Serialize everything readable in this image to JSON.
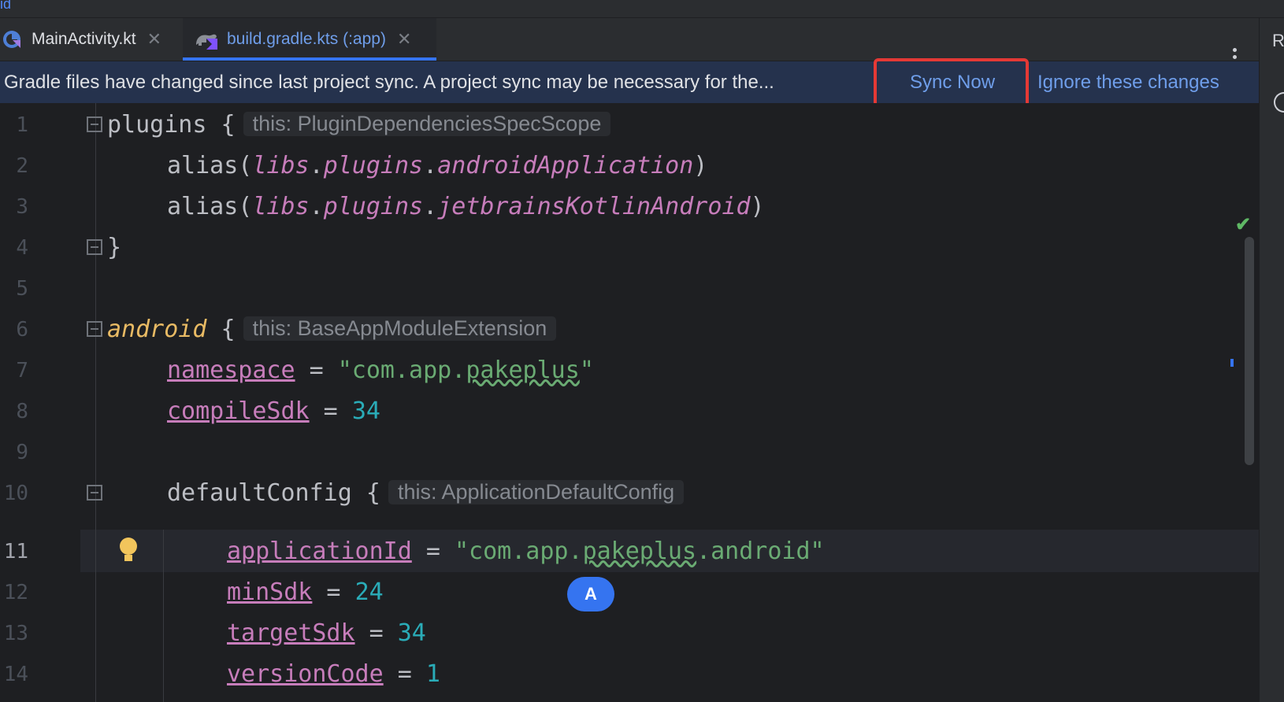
{
  "title_fragment": "id",
  "tabs": [
    {
      "label": "MainActivity.kt",
      "icon": "kotlin-file-icon",
      "active": false
    },
    {
      "label": "build.gradle.kts (:app)",
      "icon": "gradle-kts-icon",
      "active": true
    }
  ],
  "right_panel_label": "R",
  "banner": {
    "message": "Gradle files have changed since last project sync. A project sync may be necessary for the...",
    "sync_label": "Sync Now",
    "ignore_label": "Ignore these changes"
  },
  "editor": {
    "line_numbers": [
      "1",
      "2",
      "3",
      "4",
      "5",
      "6",
      "7",
      "8",
      "9",
      "10",
      "11",
      "12",
      "13",
      "14"
    ],
    "hints": {
      "plugins": "this: PluginDependenciesSpecScope",
      "android": "this: BaseAppModuleExtension",
      "defaultConfig": "this: ApplicationDefaultConfig"
    },
    "code": {
      "l1_kw": "plugins",
      "l1_brace": " {",
      "l2_fn": "alias(",
      "l2_libs": "libs",
      "l2_plugins": "plugins",
      "l2_name": "androidApplication",
      "l3_name": "jetbrainsKotlinAndroid",
      "close_paren": ")",
      "dot": ".",
      "l4": "}",
      "l6_kw": "android",
      "l7_prop": "namespace",
      "l7_str_a": "\"com.app.",
      "l7_str_b": "pakeplus",
      "l7_str_c": "\"",
      "l8_prop": "compileSdk",
      "l8_num": "34",
      "l10_kw": "defaultConfig",
      "l11_prop": "applicationId",
      "l11_str_a": "\"com.app.",
      "l11_str_b": "pakeplus",
      "l11_str_c": ".android\"",
      "l12_prop": "minSdk",
      "l12_num": "24",
      "l13_prop": "targetSdk",
      "l13_num": "34",
      "l14_prop": "versionCode",
      "l14_num": "1",
      "eq": " = "
    },
    "current_line": 11
  },
  "avatar_letter": "A",
  "colors": {
    "accent": "#3574f0",
    "highlight_box": "#e53935",
    "banner_bg": "#25324d"
  }
}
